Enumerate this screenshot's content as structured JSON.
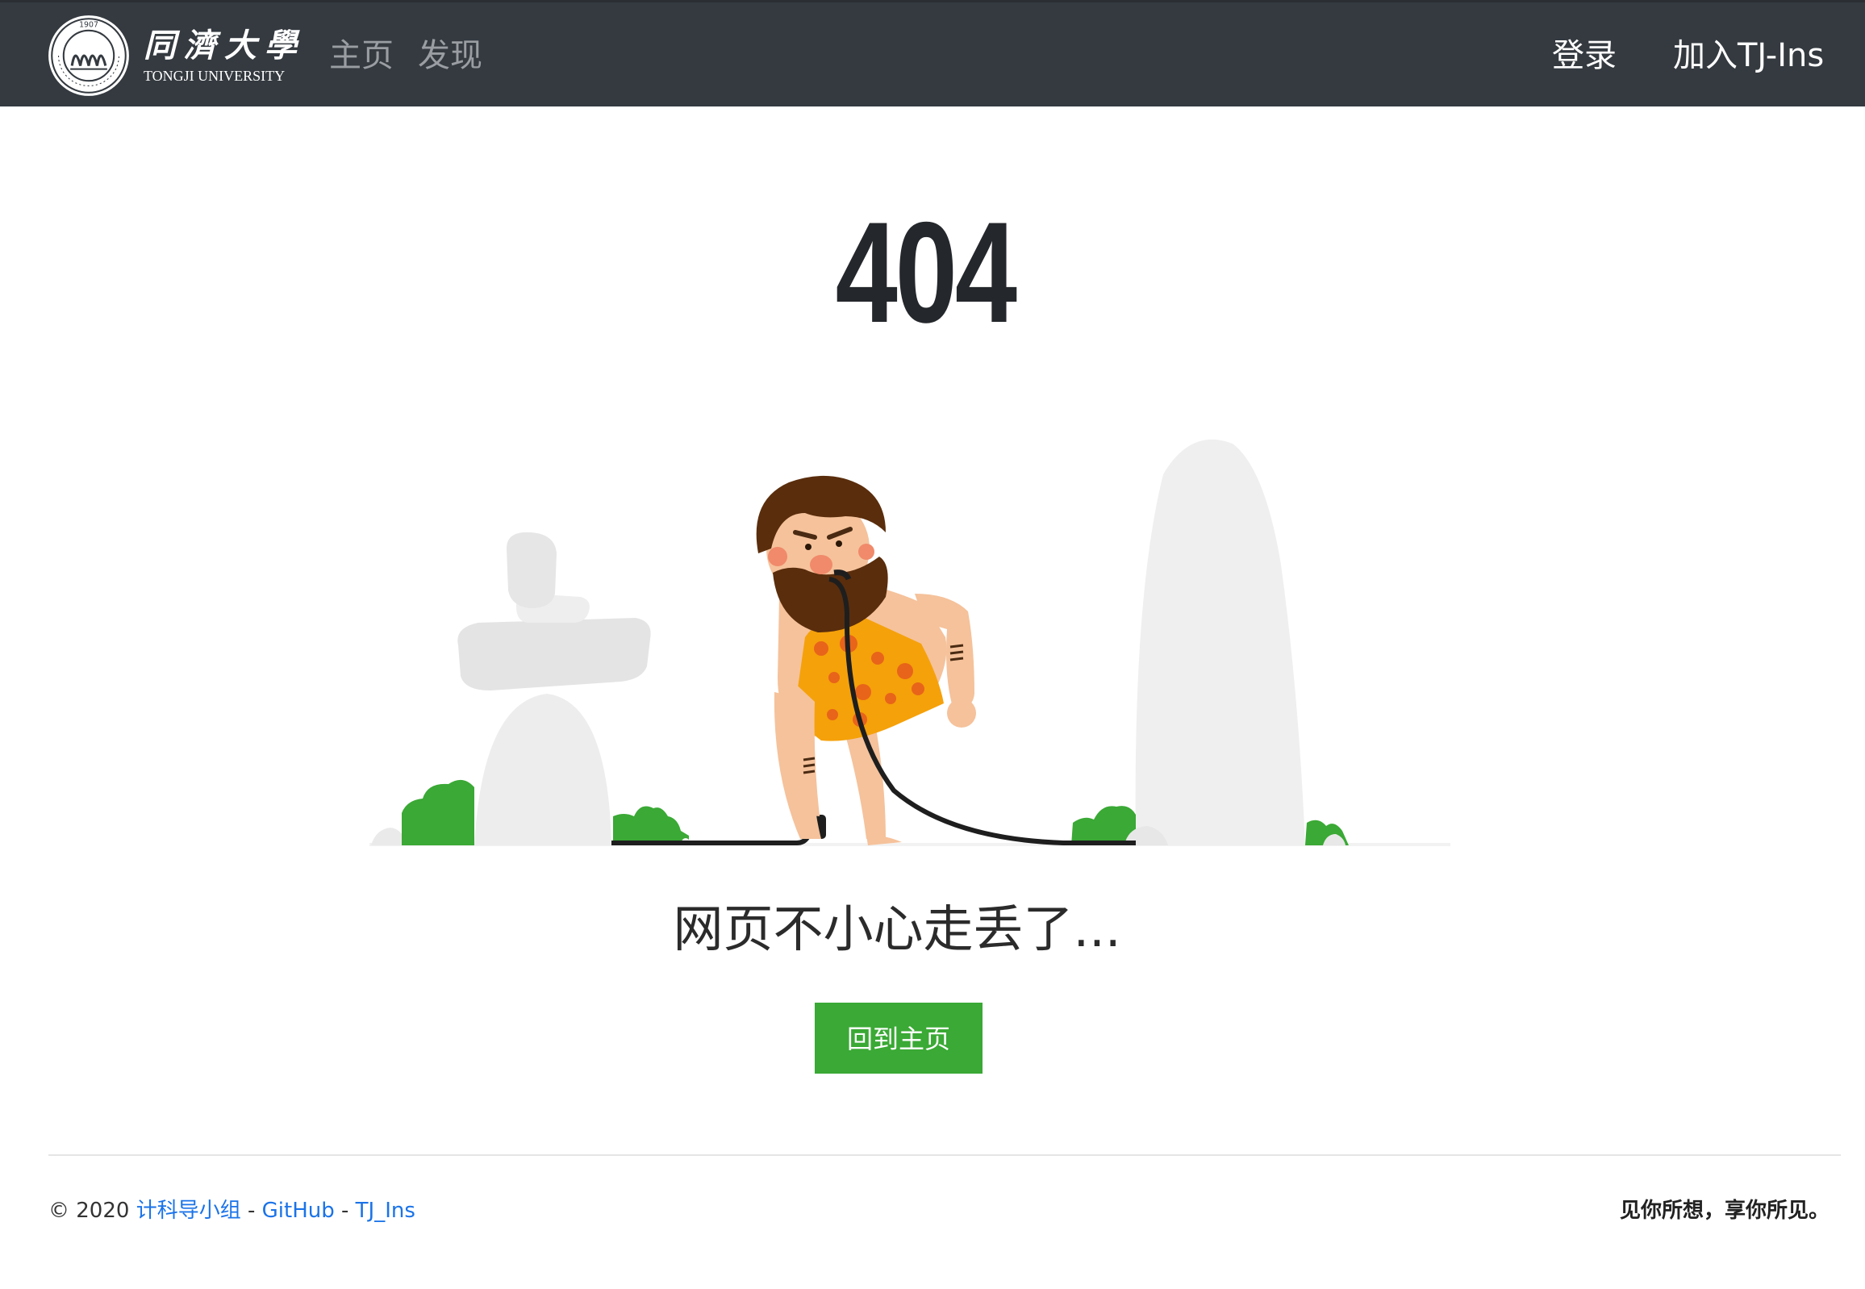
{
  "navbar": {
    "logo": {
      "name_cn": "同濟大學",
      "name_en": "TONGJI UNIVERSITY",
      "seal_year": "1907"
    },
    "links_left": [
      "主页",
      "发现"
    ],
    "links_right": [
      "登录",
      "加入TJ-Ins"
    ]
  },
  "error": {
    "code": "404",
    "message": "网页不小心走丢了...",
    "button_label": "回到主页"
  },
  "footer": {
    "copyright": "© 2020",
    "team_link": "计科导小组",
    "sep1": " - ",
    "github_link": "GitHub",
    "sep2": " - ",
    "project_link": "TJ_Ins",
    "slogan": "见你所想，享你所见。"
  },
  "colors": {
    "navbar_bg": "#343a40",
    "button_green": "#3aa935",
    "link_blue": "#1a73e8",
    "text_dark": "#24272b"
  }
}
